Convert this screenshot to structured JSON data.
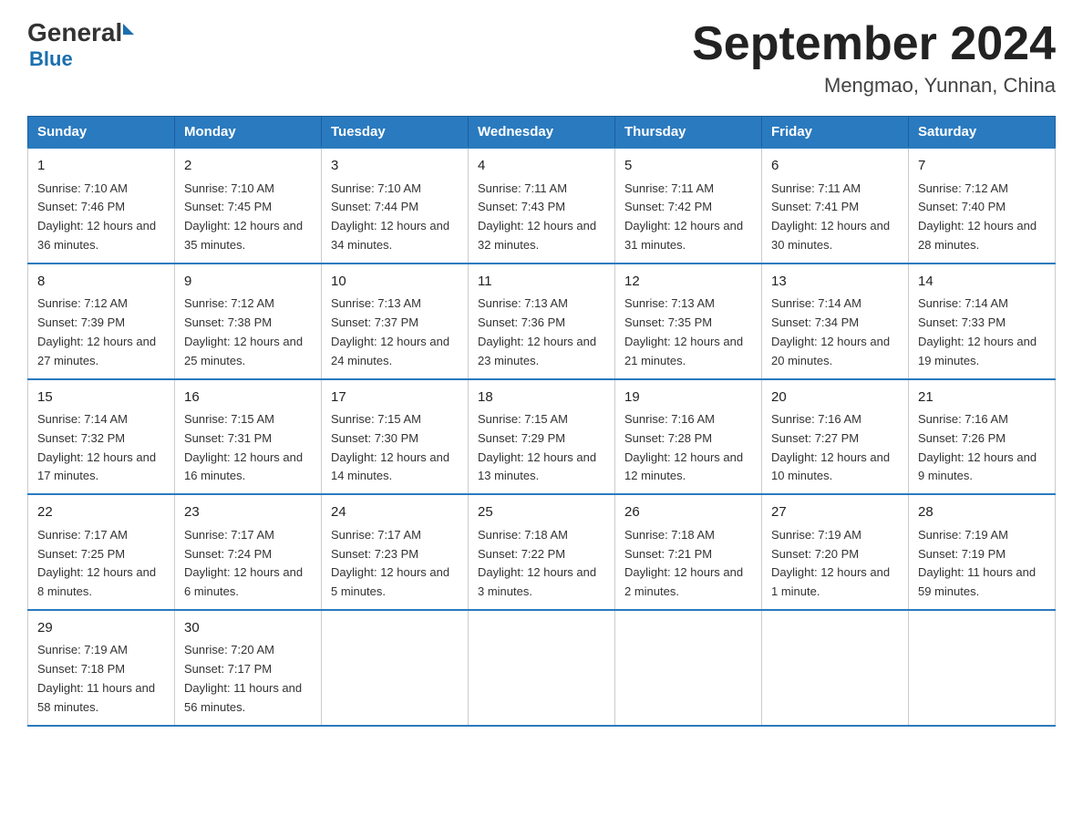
{
  "logo": {
    "text_general": "General",
    "text_blue": "Blue"
  },
  "header": {
    "month_year": "September 2024",
    "location": "Mengmao, Yunnan, China"
  },
  "weekdays": [
    "Sunday",
    "Monday",
    "Tuesday",
    "Wednesday",
    "Thursday",
    "Friday",
    "Saturday"
  ],
  "weeks": [
    [
      {
        "day": "1",
        "sunrise": "7:10 AM",
        "sunset": "7:46 PM",
        "daylight": "12 hours and 36 minutes."
      },
      {
        "day": "2",
        "sunrise": "7:10 AM",
        "sunset": "7:45 PM",
        "daylight": "12 hours and 35 minutes."
      },
      {
        "day": "3",
        "sunrise": "7:10 AM",
        "sunset": "7:44 PM",
        "daylight": "12 hours and 34 minutes."
      },
      {
        "day": "4",
        "sunrise": "7:11 AM",
        "sunset": "7:43 PM",
        "daylight": "12 hours and 32 minutes."
      },
      {
        "day": "5",
        "sunrise": "7:11 AM",
        "sunset": "7:42 PM",
        "daylight": "12 hours and 31 minutes."
      },
      {
        "day": "6",
        "sunrise": "7:11 AM",
        "sunset": "7:41 PM",
        "daylight": "12 hours and 30 minutes."
      },
      {
        "day": "7",
        "sunrise": "7:12 AM",
        "sunset": "7:40 PM",
        "daylight": "12 hours and 28 minutes."
      }
    ],
    [
      {
        "day": "8",
        "sunrise": "7:12 AM",
        "sunset": "7:39 PM",
        "daylight": "12 hours and 27 minutes."
      },
      {
        "day": "9",
        "sunrise": "7:12 AM",
        "sunset": "7:38 PM",
        "daylight": "12 hours and 25 minutes."
      },
      {
        "day": "10",
        "sunrise": "7:13 AM",
        "sunset": "7:37 PM",
        "daylight": "12 hours and 24 minutes."
      },
      {
        "day": "11",
        "sunrise": "7:13 AM",
        "sunset": "7:36 PM",
        "daylight": "12 hours and 23 minutes."
      },
      {
        "day": "12",
        "sunrise": "7:13 AM",
        "sunset": "7:35 PM",
        "daylight": "12 hours and 21 minutes."
      },
      {
        "day": "13",
        "sunrise": "7:14 AM",
        "sunset": "7:34 PM",
        "daylight": "12 hours and 20 minutes."
      },
      {
        "day": "14",
        "sunrise": "7:14 AM",
        "sunset": "7:33 PM",
        "daylight": "12 hours and 19 minutes."
      }
    ],
    [
      {
        "day": "15",
        "sunrise": "7:14 AM",
        "sunset": "7:32 PM",
        "daylight": "12 hours and 17 minutes."
      },
      {
        "day": "16",
        "sunrise": "7:15 AM",
        "sunset": "7:31 PM",
        "daylight": "12 hours and 16 minutes."
      },
      {
        "day": "17",
        "sunrise": "7:15 AM",
        "sunset": "7:30 PM",
        "daylight": "12 hours and 14 minutes."
      },
      {
        "day": "18",
        "sunrise": "7:15 AM",
        "sunset": "7:29 PM",
        "daylight": "12 hours and 13 minutes."
      },
      {
        "day": "19",
        "sunrise": "7:16 AM",
        "sunset": "7:28 PM",
        "daylight": "12 hours and 12 minutes."
      },
      {
        "day": "20",
        "sunrise": "7:16 AM",
        "sunset": "7:27 PM",
        "daylight": "12 hours and 10 minutes."
      },
      {
        "day": "21",
        "sunrise": "7:16 AM",
        "sunset": "7:26 PM",
        "daylight": "12 hours and 9 minutes."
      }
    ],
    [
      {
        "day": "22",
        "sunrise": "7:17 AM",
        "sunset": "7:25 PM",
        "daylight": "12 hours and 8 minutes."
      },
      {
        "day": "23",
        "sunrise": "7:17 AM",
        "sunset": "7:24 PM",
        "daylight": "12 hours and 6 minutes."
      },
      {
        "day": "24",
        "sunrise": "7:17 AM",
        "sunset": "7:23 PM",
        "daylight": "12 hours and 5 minutes."
      },
      {
        "day": "25",
        "sunrise": "7:18 AM",
        "sunset": "7:22 PM",
        "daylight": "12 hours and 3 minutes."
      },
      {
        "day": "26",
        "sunrise": "7:18 AM",
        "sunset": "7:21 PM",
        "daylight": "12 hours and 2 minutes."
      },
      {
        "day": "27",
        "sunrise": "7:19 AM",
        "sunset": "7:20 PM",
        "daylight": "12 hours and 1 minute."
      },
      {
        "day": "28",
        "sunrise": "7:19 AM",
        "sunset": "7:19 PM",
        "daylight": "11 hours and 59 minutes."
      }
    ],
    [
      {
        "day": "29",
        "sunrise": "7:19 AM",
        "sunset": "7:18 PM",
        "daylight": "11 hours and 58 minutes."
      },
      {
        "day": "30",
        "sunrise": "7:20 AM",
        "sunset": "7:17 PM",
        "daylight": "11 hours and 56 minutes."
      },
      null,
      null,
      null,
      null,
      null
    ]
  ]
}
